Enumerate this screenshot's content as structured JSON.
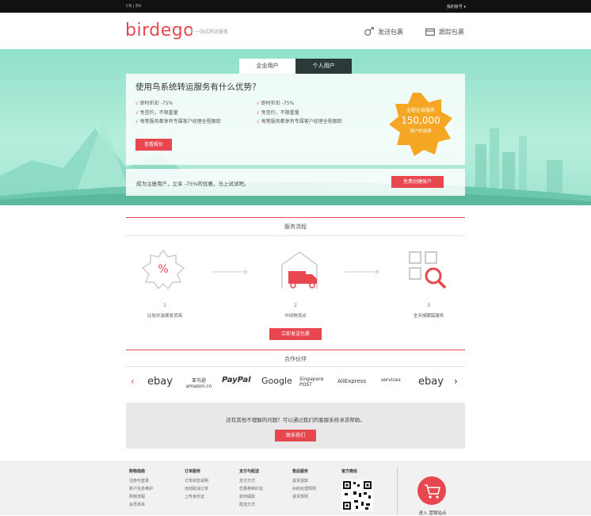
{
  "topbar": {
    "lang": "CN | EN",
    "account": "我的帐号 ▾"
  },
  "header": {
    "logo": "birdego",
    "slogan": "一站式转运服务",
    "nav_send": "发送包裹",
    "nav_track": "跟踪包裹"
  },
  "hero": {
    "tab_business": "企业用户",
    "tab_personal": "个人用户",
    "title": "使用鸟系统转运服务有什么优势？",
    "features_left": [
      "即时折扣 -75%",
      "免签约，不限重量",
      "每笔服务都享有专属客户经理全程跟踪"
    ],
    "features_right": [
      "即时折扣 -75%",
      "免签约，不限重量",
      "每笔服务都享有专属客户经理全程跟踪"
    ],
    "quote_button": "查看报价",
    "badge_line1": "全程在线服务",
    "badge_number": "150,000",
    "badge_line2": "用户的选择",
    "register_text": "成为注册用户，立享 -75%的优惠，马上试试吧。",
    "register_button": "免费创建账户"
  },
  "process": {
    "title": "服务流程",
    "steps": [
      {
        "num": "1",
        "label": "比较并选择发货商"
      },
      {
        "num": "2",
        "label": "中间物流点"
      },
      {
        "num": "3",
        "label": "全天候跟踪服务"
      }
    ],
    "send_button": "立即发送包裹"
  },
  "partners": {
    "title": "合作伙伴",
    "logos": [
      "ebay",
      "亚马逊 amazon.cn",
      "PayPal",
      "Google",
      "Singapore POST",
      "AliExpress",
      "services",
      "ebay"
    ],
    "prev": "‹",
    "next": "›"
  },
  "help": {
    "text": "还有其他不理解的问题？可以通过我们的客服系统寻求帮助。",
    "button": "联系我们"
  },
  "footer": {
    "cols": [
      {
        "title": "购物指南",
        "items": [
          "注册与登录",
          "账户信息维护",
          "购物流程",
          "会员体系"
        ]
      },
      {
        "title": "订单服务",
        "items": [
          "订单状态说明",
          "自动取消订单",
          "上传身份证"
        ]
      },
      {
        "title": "支付与配送",
        "items": [
          "支付方式",
          "优惠券和红包",
          "如何提取",
          "配送方式"
        ]
      },
      {
        "title": "售后服务",
        "items": [
          "退货退款",
          "纠纷处理规则",
          "退货规则"
        ]
      },
      {
        "title": "官方微信",
        "items": []
      }
    ],
    "store_label": "进入 营销站点"
  },
  "colors": {
    "accent": "#e9474f",
    "hero_bg": "#9fe3cf",
    "dark_tab": "#2b3a38",
    "badge": "#f5a623"
  }
}
